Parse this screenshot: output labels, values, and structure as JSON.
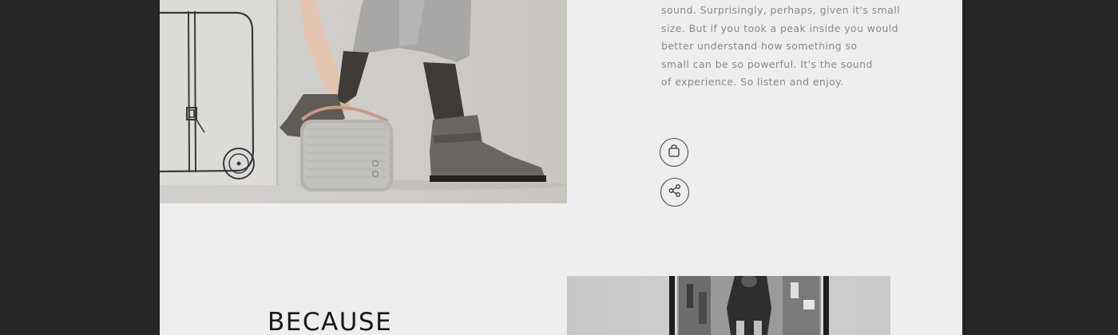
{
  "description": {
    "lines": [
      "sound. Surprisingly, perhaps, given it's small",
      "size. But if you took a peak inside you would",
      "better understand how something so",
      "small can be so powerful. It's the sound",
      "of experience. So listen and enjoy."
    ]
  },
  "actions": {
    "bag_icon": "shopping-bag-icon",
    "share_icon": "share-icon"
  },
  "next_section": {
    "heading": "BECAUSE"
  },
  "colors": {
    "page_background": "#eeeeee",
    "outer_background": "#262626",
    "body_text": "#8a8a8a",
    "heading_text": "#1a1a1a"
  }
}
